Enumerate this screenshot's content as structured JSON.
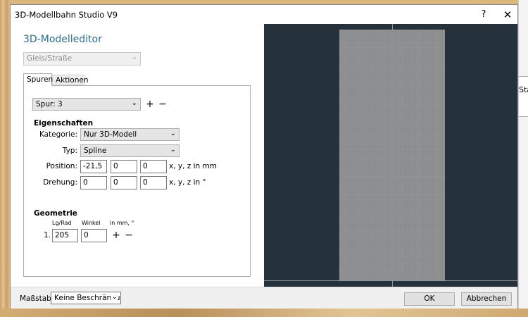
{
  "window": {
    "title": "3D-Modellbahn Studio V9",
    "help": "?",
    "close": "✕"
  },
  "editor": {
    "heading": "3D-Modelleditor",
    "object_type": "Gleis/Straße",
    "tabs": [
      "Spuren",
      "Aktionen"
    ],
    "track_select": "Spur: 3",
    "add_symbol": "+",
    "remove_symbol": "−",
    "properties": {
      "heading": "Eigenschaften",
      "category_label": "Kategorie:",
      "category_value": "Nur 3D-Modell",
      "type_label": "Typ:",
      "type_value": "Spline",
      "position_label": "Position:",
      "position": [
        "-21,5",
        "0",
        "0"
      ],
      "position_unit": "x, y, z in mm",
      "rotation_label": "Drehung:",
      "rotation": [
        "0",
        "0",
        "0"
      ],
      "rotation_unit": "x, y, z in °"
    },
    "geometry": {
      "heading": "Geometrie",
      "col_length": "Lg/Rad",
      "col_angle": "Winkel",
      "col_unit": "in mm, °",
      "rows": [
        {
          "index": "1.",
          "length": "205",
          "angle": "0"
        }
      ]
    }
  },
  "footer": {
    "scale_label": "Maßstab:",
    "scale_value": "Keine Beschränkung",
    "ok": "OK",
    "cancel": "Abbrechen"
  },
  "background": {
    "partial_text": "Sta"
  }
}
